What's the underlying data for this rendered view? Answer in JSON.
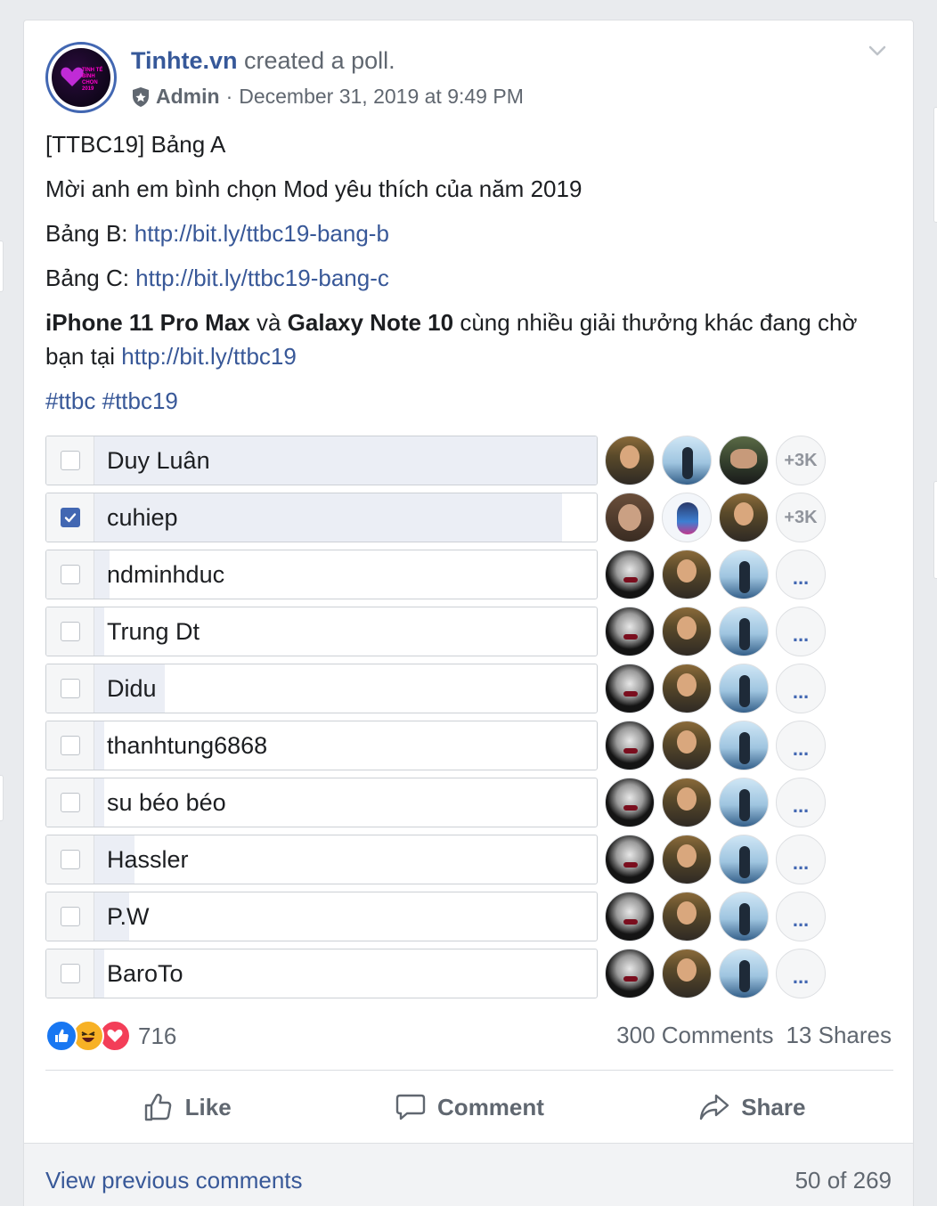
{
  "post": {
    "page_name": "Tinhte.vn",
    "action": "created a poll.",
    "role": "Admin",
    "separator": "·",
    "timestamp": "December 31, 2019 at 9:49 PM",
    "avatar_logo_text": "TINH TẾ BÌNH CHỌN 2019"
  },
  "body": {
    "line1": "[TTBC19] Bảng A",
    "line2": "Mời anh em bình chọn Mod yêu thích của năm 2019",
    "line3_prefix": "Bảng B: ",
    "line3_link": "http://bit.ly/ttbc19-bang-b",
    "line4_prefix": "Bảng C: ",
    "line4_link": "http://bit.ly/ttbc19-bang-c",
    "promo_bold1": "iPhone 11 Pro Max",
    "promo_and": " và ",
    "promo_bold2": "Galaxy Note 10",
    "promo_rest": " cùng nhiều giải thưởng khác đang chờ bạn tại ",
    "promo_link": "http://bit.ly/ttbc19",
    "hashtag1": "#ttbc",
    "hashtag2": "#ttbc19"
  },
  "poll": {
    "options": [
      {
        "label": "Duy Luân",
        "checked": false,
        "share": 1.0,
        "more": "+3K"
      },
      {
        "label": "cuhiep",
        "checked": true,
        "share": 0.93,
        "more": "+3K"
      },
      {
        "label": "ndminhduc",
        "checked": false,
        "share": 0.03,
        "more": "..."
      },
      {
        "label": "Trung Dt",
        "checked": false,
        "share": 0.02,
        "more": "..."
      },
      {
        "label": "Didu",
        "checked": false,
        "share": 0.14,
        "more": "..."
      },
      {
        "label": "thanhtung6868",
        "checked": false,
        "share": 0.02,
        "more": "..."
      },
      {
        "label": "su béo béo",
        "checked": false,
        "share": 0.02,
        "more": "..."
      },
      {
        "label": "Hassler",
        "checked": false,
        "share": 0.08,
        "more": "..."
      },
      {
        "label": "P.W",
        "checked": false,
        "share": 0.07,
        "more": "..."
      },
      {
        "label": "BaroTo",
        "checked": false,
        "share": 0.02,
        "more": "..."
      }
    ]
  },
  "engagement": {
    "reaction_icons": [
      "like-icon",
      "haha-icon",
      "love-icon"
    ],
    "reaction_count": "716",
    "comments": "300 Comments",
    "shares": "13 Shares"
  },
  "actions": {
    "like": "Like",
    "comment": "Comment",
    "share": "Share"
  },
  "comments": {
    "view_previous": "View previous comments",
    "count": "50 of 269"
  },
  "colors": {
    "link": "#385898",
    "accent": "#4267b2",
    "poll_fill": "#ebeef5"
  }
}
